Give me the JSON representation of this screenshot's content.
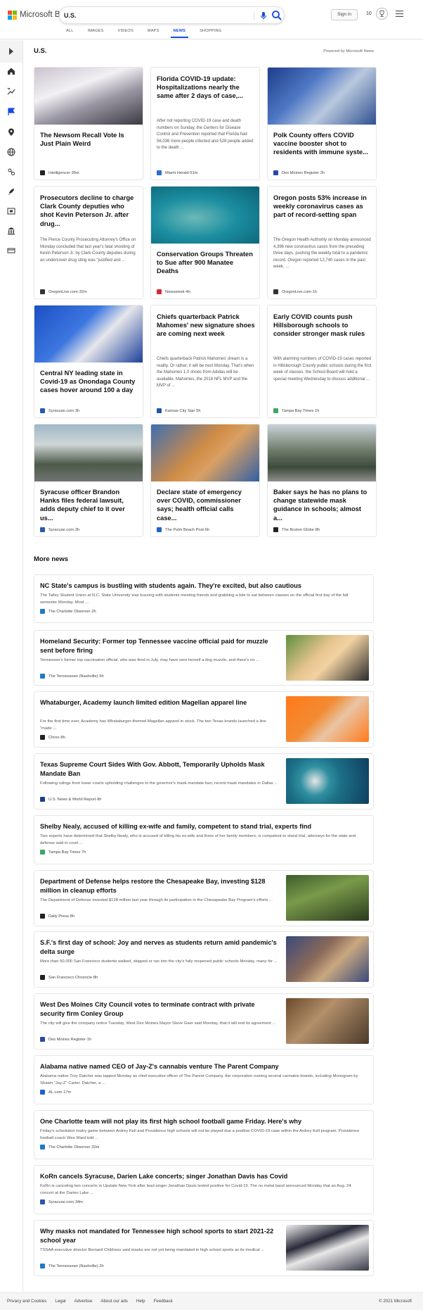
{
  "brand": {
    "name": "Microsoft Bing"
  },
  "search": {
    "value": "U.S."
  },
  "header": {
    "sign_in": "Sign in",
    "rewards": "10"
  },
  "tabs": [
    {
      "label": "ALL"
    },
    {
      "label": "IMAGES"
    },
    {
      "label": "VIDEOS"
    },
    {
      "label": "MAPS"
    },
    {
      "label": "NEWS"
    },
    {
      "label": "SHOPPING"
    }
  ],
  "active_tab": "NEWS",
  "section": {
    "title": "U.S.",
    "powered": "Powered by Microsoft News"
  },
  "cards": [
    {
      "title": "The Newsom Recall Vote Is Just Plain Weird",
      "snippet": "",
      "source": "Intelligencer",
      "age": "35m",
      "has_image": true,
      "fav": "#222"
    },
    {
      "title": "Florida COVID-19 update: Hospitalizations nearly the same after 2 days of case,...",
      "snippet": "After not reporting COVID-19 case and death numbers on Sunday, the Centers for Disease Control and Prevention reported that Florida had 56,036 more people infected and 528 people added to the death ...",
      "source": "Miami Herald",
      "age": "51m",
      "has_image": false,
      "fav": "#2a6cd6"
    },
    {
      "title": "Polk County offers COVID vaccine booster shot to residents with immune syste...",
      "snippet": "",
      "source": "Des Moines Register",
      "age": "2h",
      "has_image": true,
      "fav": "#2a4aa8"
    },
    {
      "title": "Prosecutors decline to charge Clark County deputies who shot Kevin Peterson Jr. after drug...",
      "snippet": "The Pierce County Prosecuting Attorney's Office on Monday concluded that last year's fatal shooting of Kevin Peterson Jr. by Clark County deputies during an undercover drug sting was \"justified and ...",
      "source": "OregonLive.com",
      "age": "32m",
      "has_image": false,
      "fav": "#333"
    },
    {
      "title": "Conservation Groups Threaten to Sue after 900 Manatee Deaths",
      "snippet": "",
      "source": "Newsweek",
      "age": "4h",
      "has_image": true,
      "fav": "#d6282f"
    },
    {
      "title": "Oregon posts 53% increase in weekly coronavirus cases as part of record-setting span",
      "snippet": "The Oregon Health Authority on Monday announced 4,396 new coronavirus cases from the preceding three days, pushing the weekly total to a pandemic record. Oregon reported 12,740 cases in the past week, ...",
      "source": "OregonLive.com",
      "age": "1h",
      "has_image": false,
      "fav": "#333"
    },
    {
      "title": "Central NY leading state in Covid-19 as Onondaga County cases hover around 100 a day",
      "snippet": "",
      "source": "Syracuse.com",
      "age": "3h",
      "has_image": true,
      "fav": "#2a5aa8"
    },
    {
      "title": "Chiefs quarterback Patrick Mahomes' new signature shoes are coming next week",
      "snippet": "Chiefs quarterback Patrick Mahomes' dream is a reality. Or rather, it will be next Monday. That's when the Mahomes 1.0 shoes from Adidas will be available. Mahomes, the 2018 NFL MVP and the MVP of ...",
      "source": "Kansas City Star",
      "age": "5h",
      "has_image": false,
      "fav": "#1e5aa0"
    },
    {
      "title": "Early COVID counts push Hillsborough schools to consider stronger mask rules",
      "snippet": "With alarming numbers of COVID-19 cases reported in Hillsborough County public schools during the first week of classes, the School Board will hold a special meeting Wednesday to discuss additional ...",
      "source": "Tampa Bay Times",
      "age": "1h",
      "has_image": false,
      "fav": "#3aa86a"
    },
    {
      "title": "Syracuse officer Brandon Hanks files federal lawsuit, adds deputy chief to it over us...",
      "snippet": "",
      "source": "Syracuse.com",
      "age": "3h",
      "has_image": true,
      "fav": "#2a5aa8"
    },
    {
      "title": "Declare state of emergency over COVID, commissioner says; health official calls case...",
      "snippet": "",
      "source": "The Palm Beach Post",
      "age": "6h",
      "has_image": true,
      "fav": "#1f63c8"
    },
    {
      "title": "Baker says he has no plans to change statewide mask guidance in schools; almost a...",
      "snippet": "",
      "source": "The Boston Globe",
      "age": "8h",
      "has_image": true,
      "fav": "#222"
    }
  ],
  "more_news": {
    "title": "More news",
    "items": [
      {
        "title": "NC State's campus is bustling with students again. They're excited, but also cautious",
        "snippet": "The Talley Student Union at N.C. State University was buzzing with students meeting friends and grabbing a bite to eat between classes on the official first day of the fall semester Monday. Most ...",
        "source": "The Charlotte Observer",
        "age": "2h",
        "thumb": false,
        "fav": "#1f7ac8"
      },
      {
        "title": "Homeland Security: Former top Tennessee vaccine official paid for muzzle sent before firing",
        "snippet": "Tennessee's former top vaccination official, who was fired in July, may have sent herself a dog muzzle, and there's no ...",
        "source": "The Tennessean (Nashville)",
        "age": "5h",
        "thumb": true,
        "fav": "#1f7ac8"
      },
      {
        "title": "Whataburger, Academy launch limited edition Magellan apparel line",
        "snippet": "For the first time ever, Academy has Whataburger-themed Magellan apparel in stock. The two Texas brands launched a line \"made ...",
        "source": "Chron",
        "age": "8h",
        "thumb": true,
        "fav": "#222"
      },
      {
        "title": "Texas Supreme Court Sides With Gov. Abbott, Temporarily Upholds Mask Mandate Ban",
        "snippet": "Following rulings from lower courts upholding challenges to the governor's mask mandate ban, recent mask mandates in Dallas ...",
        "source": "U.S. News & World Report",
        "age": "9h",
        "thumb": true,
        "fav": "#1a3f8a"
      },
      {
        "title": "Shelby Nealy, accused of killing ex-wife and family, competent to stand trial, experts find",
        "snippet": "Two experts have determined that Shelby Nealy, who is accused of killing his ex-wife and three of her family members, is competent to stand trial, attorneys for the state and defense said in court ...",
        "source": "Tampa Bay Times",
        "age": "7h",
        "thumb": false,
        "fav": "#3aa86a"
      },
      {
        "title": "Department of Defense helps restore the Chesapeake Bay, investing $128 million in cleanup efforts",
        "snippet": "The Department of Defense invested $128 million last year through its participation in the Chesapeake Bay Program's efforts ...",
        "source": "Daily Press",
        "age": "8h",
        "thumb": true,
        "fav": "#222"
      },
      {
        "title": "S.F.'s first day of school: Joy and nerves as students return amid pandemic's delta surge",
        "snippet": "More than 50,000 San Francisco students walked, skipped or ran into the city's fully reopened public schools Monday, many for ...",
        "source": "San Francisco Chronicle",
        "age": "8h",
        "thumb": true,
        "fav": "#222"
      },
      {
        "title": "West Des Moines City Council votes to terminate contract with private security firm Conley Group",
        "snippet": "The city will give the company notice Tuesday, West Des Moines Mayor Steve Gaer said Monday, that it will end its agreement ...",
        "source": "Des Moines Register",
        "age": "1h",
        "thumb": true,
        "fav": "#2a4aa8"
      },
      {
        "title": "Alabama native named CEO of Jay-Z's cannabis venture The Parent Company",
        "snippet": "Alabama native Troy Datcher was tapped Monday as chief executive officer of The Parent Company, the corporation owning several cannabis brands, including Monogram by Shawn \"Jay-Z\" Carter. Datcher, a ...",
        "source": "AL.com",
        "age": "17m",
        "thumb": false,
        "fav": "#1f63c8"
      },
      {
        "title": "One Charlotte team will not play its first high school football game Friday. Here's why",
        "snippet": "Friday's scheduled rivalry game between Ardrey Kell and Providence high schools will not be played due a positive COVID-19 case within the Ardrey Kell program. Providence football coach Wes Ward told ...",
        "source": "The Charlotte Observer",
        "age": "32m",
        "thumb": false,
        "fav": "#1f7ac8"
      },
      {
        "title": "KoRn cancels Syracuse, Darien Lake concerts; singer Jonathan Davis has Covid",
        "snippet": "KoRn is canceling two concerts in Upstate New York after lead singer Jonathan Davis tested positive for Covid-19. The nu metal band announced Monday that an Aug. 24 concert at the Darien Lake ...",
        "source": "Syracuse.com",
        "age": "34m",
        "thumb": false,
        "fav": "#2a5aa8"
      },
      {
        "title": "Why masks not mandated for Tennessee high school sports to start 2021-22 school year",
        "snippet": "TSSAA executive director Bernard Childress said masks are not yet being mandated in high school sports as its medical ...",
        "source": "The Tennessean (Nashville)",
        "age": "2h",
        "thumb": true,
        "fav": "#1f7ac8"
      }
    ]
  },
  "footer": {
    "links": [
      "Privacy and Cookies",
      "Legal",
      "Advertise",
      "About our ads",
      "Help",
      "Feedback"
    ],
    "copyright": "© 2021 Microsoft"
  }
}
